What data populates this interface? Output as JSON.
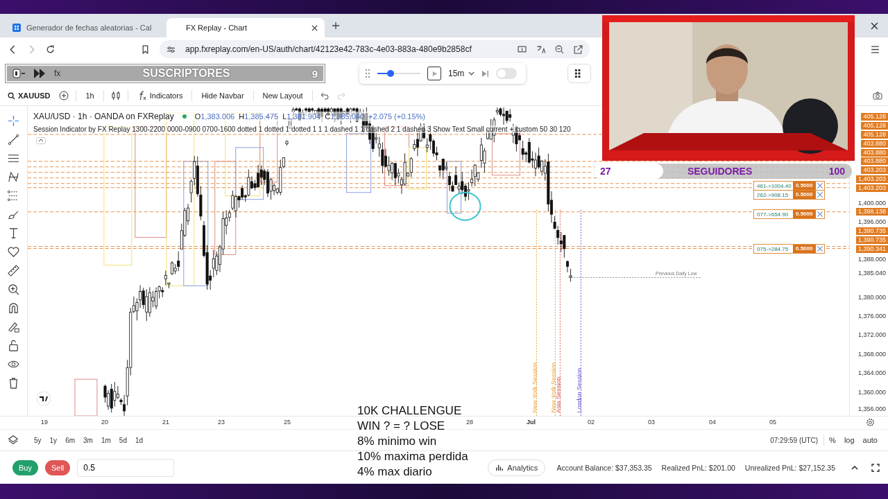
{
  "browser": {
    "tabs": [
      {
        "title": "Generador de fechas aleatorias - Cal",
        "selected": false
      },
      {
        "title": "FX Replay - Chart",
        "selected": true
      }
    ],
    "address": "app.fxreplay.com/en-US/auth/chart/42123e42-783c-4e03-883a-480e9b2858cf"
  },
  "subscriber_overlay": {
    "fx": "fx",
    "label": "SUSCRIPTORES",
    "count": "9"
  },
  "replay_controls": {
    "level": 0.3,
    "timeframe": "15m",
    "autoplay_on": false
  },
  "toolbar": {
    "symbol": "XAUUSD",
    "interval": "1h",
    "buttons": [
      "Indicators",
      "Hide Navbar",
      "New Layout"
    ]
  },
  "chart": {
    "title": "XAU/USD · 1h · OANDA on FXReplay",
    "live": true,
    "ohlc": [
      {
        "label": "O",
        "value": "1,383.006"
      },
      {
        "label": "H",
        "value": "1,385.475"
      },
      {
        "label": "L",
        "value": "1,381.904"
      },
      {
        "label": "C",
        "value": "1,385.040"
      }
    ],
    "change": "+2.075 (+0.15%)",
    "indicator": "Session Indicator by FX Replay 1300-2200 0000-0900 0700-1600 dotted 1 dotted 1 dotted 1 1 1 dashed 1 1 dashed 2 1 dashed 3 Show Text Small current + custom 50 30 120",
    "session_labels": [
      {
        "text": "New York Session",
        "color": "#e8a33d"
      },
      {
        "text": "New York Session",
        "color": "#e8a33d"
      },
      {
        "text": "Asia Session",
        "color": "#e05656"
      },
      {
        "text": "London Session",
        "color": "#6a5acd"
      }
    ],
    "previous_daily_low": "Previous Daily Low",
    "orders": [
      {
        "label": "461->1004.40",
        "quantity": "0.5000"
      },
      {
        "label": "262->908.15",
        "quantity": "0.5000"
      },
      {
        "label": "077->654.90",
        "quantity": "0.5000"
      },
      {
        "label": "075->284.75",
        "quantity": "0.5000"
      }
    ],
    "price_tags": [
      "405.128",
      "405.128",
      "405.128",
      "403.880",
      "403.880",
      "403.880",
      "403.203",
      "1,403.203",
      "1,403.203",
      "1,398.138",
      "1,390.735",
      "1,390.735",
      "1,390.341"
    ],
    "price_ticks": [
      "1,400.000",
      "1,396.000",
      "1,388.000",
      "1,385.040",
      "1,380.000",
      "1,376.000",
      "1,372.000",
      "1,368.000",
      "1,364.000",
      "1,360.000",
      "1,356.000"
    ],
    "dates": [
      "19",
      "20",
      "21",
      "23",
      "25",
      "28",
      "Jul",
      "02",
      "03",
      "04",
      "05"
    ]
  },
  "ranges": [
    "5y",
    "1y",
    "6m",
    "3m",
    "1m",
    "5d",
    "1d"
  ],
  "clock": "07:29:59 (UTC)",
  "scale_options": [
    "%",
    "log",
    "auto"
  ],
  "order_entry": {
    "buy": "Buy",
    "sell": "Sell",
    "quantity": "0.5"
  },
  "account": {
    "analytics": "Analytics",
    "balance": "Account Balance: $37,353.35",
    "realized": "Realized PnL: $201.00",
    "unrealized": "Unrealized PnL: $27,152.35"
  },
  "challenge_overlay": [
    "10K CHALLENGUE",
    "WIN ? = ? LOSE",
    "8% minimo win",
    "10% maxima perdida",
    "4% max diario"
  ],
  "followers_overlay": {
    "count": "27",
    "label": "SEGUIDORES",
    "goal": "100",
    "level": 0.27
  },
  "webcam": {
    "kind": "picture"
  }
}
